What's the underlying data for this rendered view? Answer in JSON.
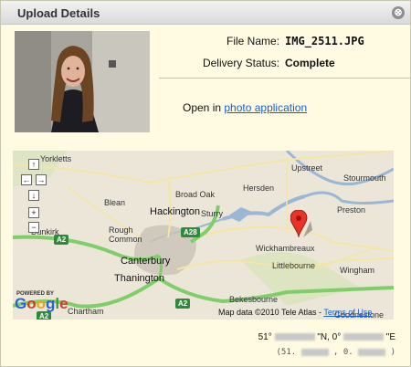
{
  "dialog": {
    "title": "Upload Details",
    "close_label": "⊗"
  },
  "photo": {
    "alt": "Uploaded photo"
  },
  "details": {
    "file_name_label": "File Name:",
    "file_name_value": "IMG_2511.JPG",
    "delivery_status_label": "Delivery Status:",
    "delivery_status_value": "Complete"
  },
  "open_in": {
    "prefix": "Open in",
    "link_text": "photo application"
  },
  "map": {
    "places": [
      "Yorkletts",
      "Upstreet",
      "Stourmouth",
      "Blean",
      "Broad Oak",
      "Hersden",
      "Hackington",
      "Sturry",
      "Preston",
      "Rough Common",
      "Wickhambreaux",
      "Canterbury",
      "Littlebourne",
      "Wingham",
      "Thanington",
      "Bekesbourne",
      "Chartham",
      "Goodnestone",
      "Dunkirk"
    ],
    "roads": [
      "A2",
      "A28",
      "A2",
      "A2"
    ],
    "powered_by": "POWERED BY",
    "logo": "Google",
    "credit": "Map data ©2010 Tele Atlas -",
    "terms_link": "Terms of Use"
  },
  "coordinates": {
    "lat_prefix": "51°",
    "lat_suffix": "\"N, 0°",
    "lon_suffix": "\"E",
    "decimal_prefix": "(51.",
    "decimal_mid": ", 0.",
    "decimal_suffix": ")"
  },
  "colors": {
    "panel": "#fefbe2",
    "link": "#1a5fc8",
    "road_major": "#7fce6a",
    "road_minor": "#f5e5a4",
    "water": "#9bb7d6",
    "marker": "#e8322a"
  },
  "icons": [
    "close-icon",
    "pan-up-icon",
    "pan-left-icon",
    "pan-right-icon",
    "pan-down-icon",
    "zoom-in-icon",
    "zoom-out-icon",
    "map-marker-icon"
  ]
}
